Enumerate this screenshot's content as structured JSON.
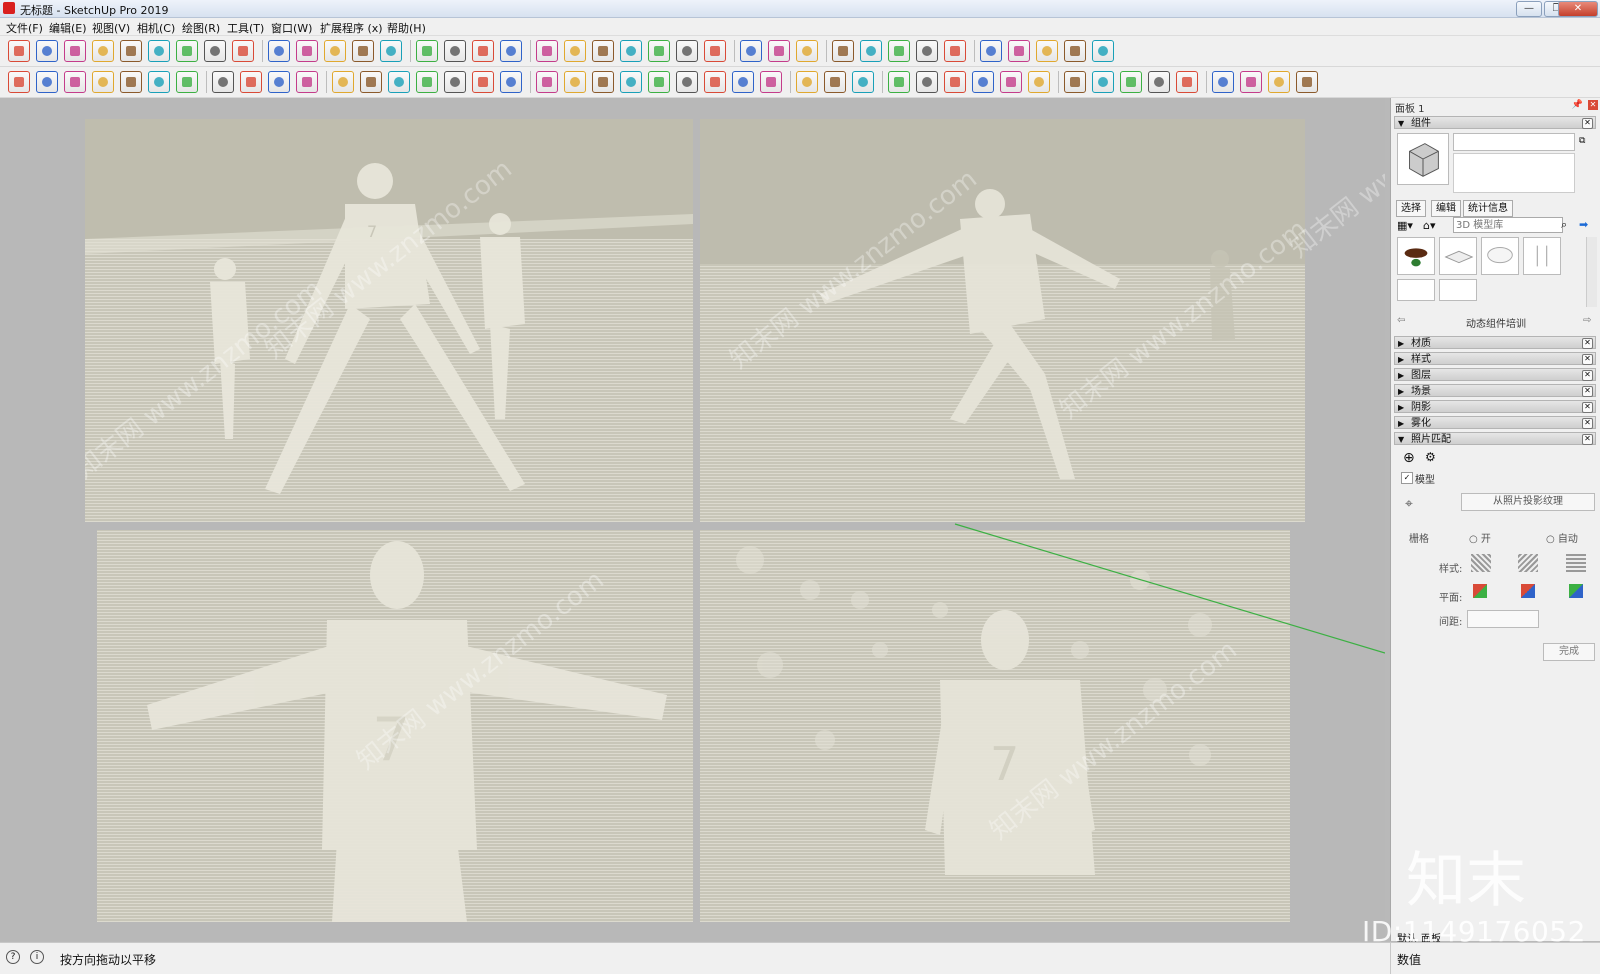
{
  "window": {
    "title": "无标题 - SketchUp Pro 2019",
    "minimize": "—",
    "maximize": "❐",
    "close": "✕"
  },
  "menu": [
    "文件(F)",
    "编辑(E)",
    "视图(V)",
    "相机(C)",
    "绘图(R)",
    "工具(T)",
    "窗口(W)",
    "扩展程序 (x)",
    "帮助(H)"
  ],
  "viewport": {
    "watermark_text": "知末网 www.znzmo.com",
    "axis_color": "#3cb043"
  },
  "panel": {
    "title": "面板 1",
    "components_header": "组件",
    "tabs": [
      "选择",
      "编辑",
      "统计信息"
    ],
    "search_placeholder": "3D 模型库",
    "collection_label": "动态组件培训",
    "sections": [
      "材质",
      "样式",
      "图层",
      "场景",
      "阴影",
      "雾化",
      "照片匹配"
    ],
    "model_checkbox_label": "模型",
    "project_texture_button": "从照片投影纹理",
    "grid_label": "栅格",
    "grid_on": "开",
    "grid_auto": "自动",
    "style_label": "样式:",
    "plane_label": "平面:",
    "spacing_label": "间距:",
    "done_button": "完成",
    "bottom_tabs": [
      "默认",
      "面板"
    ]
  },
  "status": {
    "hint": "按方向拖动以平移",
    "measure_label": "数值"
  },
  "overlay": {
    "id_text": "ID:1149176052",
    "logo_text": "知末"
  }
}
